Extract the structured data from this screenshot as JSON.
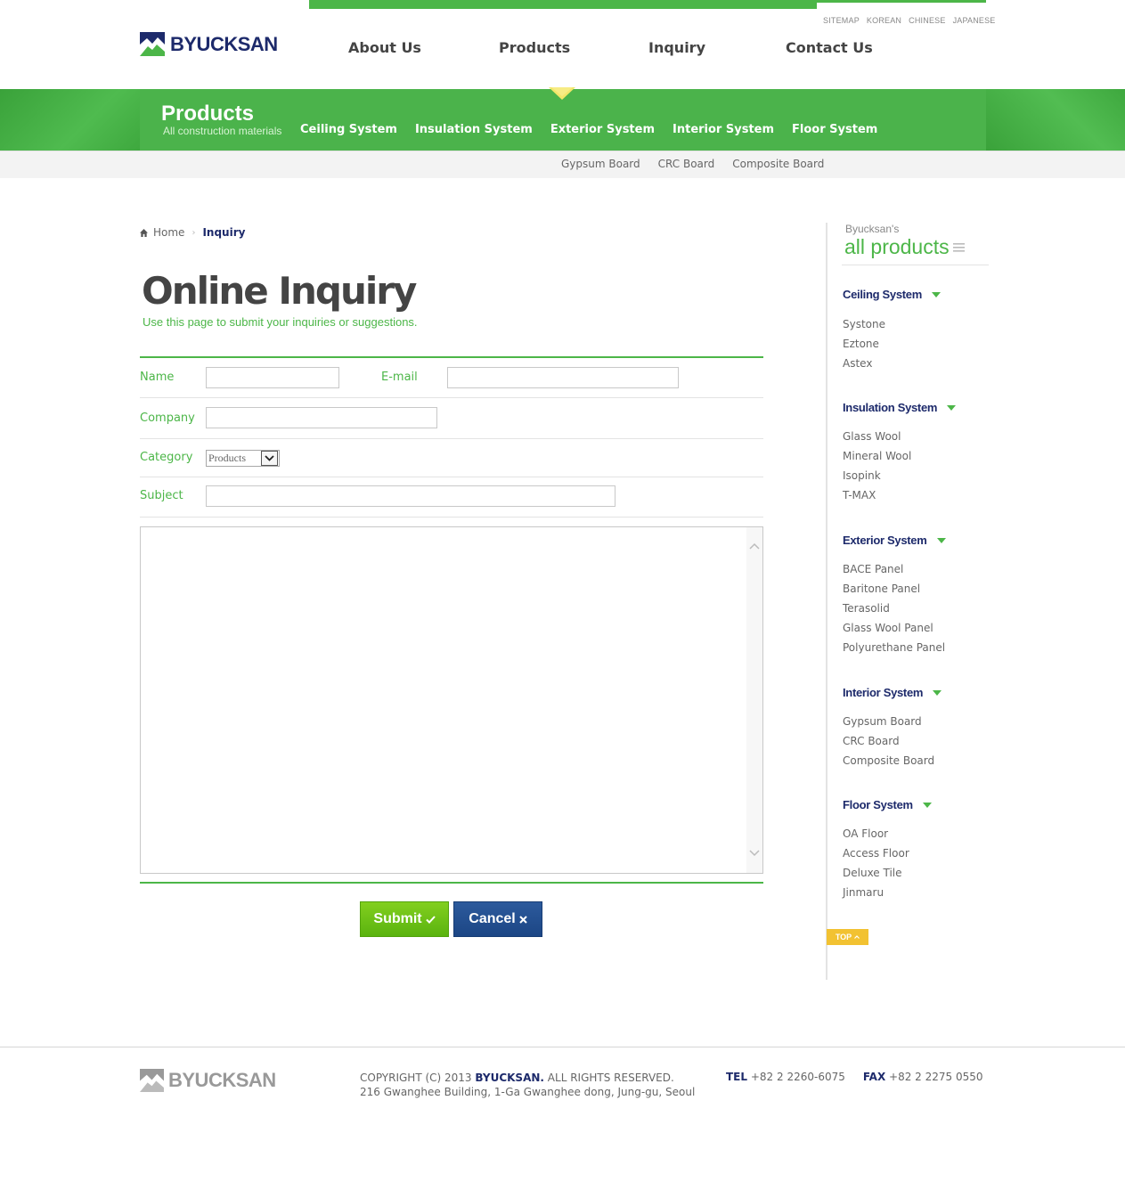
{
  "header": {
    "brand": "BYUCKSAN",
    "util_links": [
      "SITEMAP",
      "KOREAN",
      "CHINESE",
      "JAPANESE"
    ],
    "main_nav": [
      "About Us",
      "Products",
      "Inquiry",
      "Contact Us"
    ]
  },
  "subnav": {
    "section_title": "Products",
    "section_subtitle": "All construction materials",
    "categories": [
      "Ceiling System",
      "Insulation System",
      "Exterior System",
      "Interior System",
      "Floor System"
    ],
    "product_links": [
      "Gypsum Board",
      "CRC Board",
      "Composite Board"
    ]
  },
  "breadcrumb": {
    "home": "Home",
    "current": "Inquiry"
  },
  "page": {
    "title": "Online Inquiry",
    "description": "Use this page to submit your inquiries or suggestions."
  },
  "form": {
    "name_label": "Name",
    "email_label": "E-mail",
    "company_label": "Company",
    "category_label": "Category",
    "category_value": "Products",
    "subject_label": "Subject",
    "submit_label": "Submit",
    "cancel_label": "Cancel"
  },
  "sidebar": {
    "caption": "Byucksan's",
    "title": "all products",
    "groups": [
      {
        "title": "Ceiling System",
        "items": [
          "Systone",
          "Eztone",
          "Astex"
        ]
      },
      {
        "title": "Insulation System",
        "items": [
          "Glass Wool",
          "Mineral Wool",
          "Isopink",
          "T-MAX"
        ]
      },
      {
        "title": "Exterior System",
        "items": [
          "BACE Panel",
          "Baritone Panel",
          "Terasolid",
          "Glass Wool Panel",
          "Polyurethane Panel"
        ]
      },
      {
        "title": "Interior System",
        "items": [
          "Gypsum Board",
          "CRC Board",
          "Composite Board"
        ]
      },
      {
        "title": "Floor System",
        "items": [
          "OA Floor",
          "Access Floor",
          "Deluxe Tile",
          "Jinmaru"
        ]
      }
    ],
    "top_label": "TOP"
  },
  "footer": {
    "brand": "BYUCKSAN",
    "copyright_prefix": "COPYRIGHT (C) 2013",
    "copyright_brand": "BYUCKSAN.",
    "copyright_suffix": "ALL RIGHTS RESERVED.",
    "address": "216 Gwanghee Building, 1-Ga Gwanghee dong, Jung-gu, Seoul",
    "tel_label": "TEL",
    "tel": "+82 2 2260-6075",
    "fax_label": "FAX",
    "fax": "+82 2 2275 0550"
  },
  "colors": {
    "brand_green": "#4cb648",
    "brand_navy": "#1d2a6b",
    "submit_green": "#6cc117",
    "cancel_blue": "#234f91",
    "top_yellow": "#f2c232"
  }
}
